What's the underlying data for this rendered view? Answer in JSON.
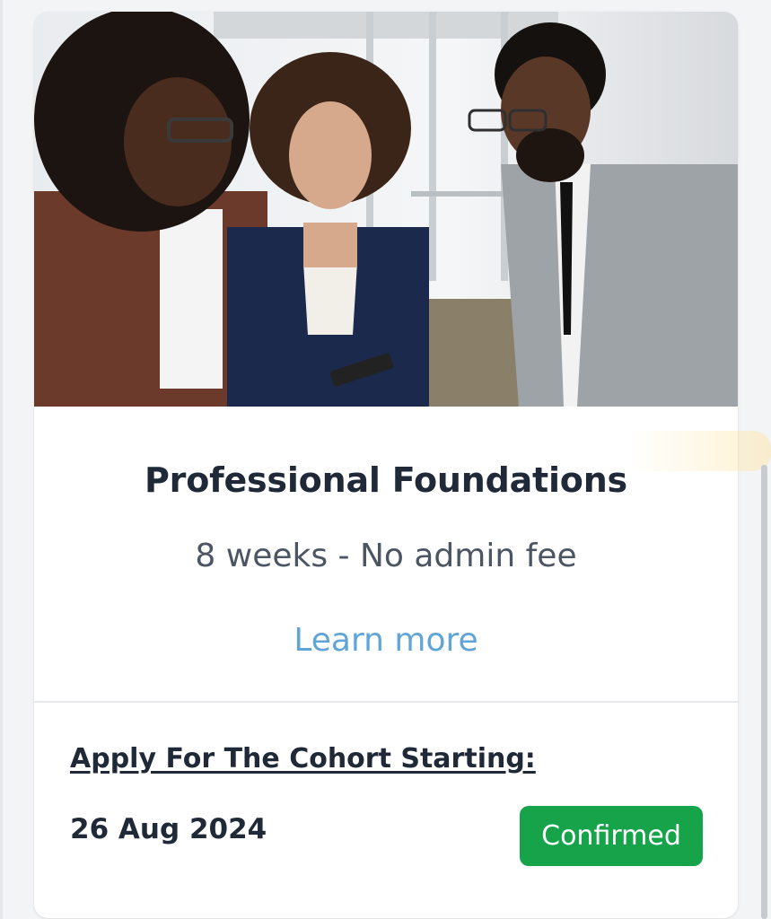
{
  "card": {
    "image_alt": "Three professionals looking at a phone",
    "title": "Professional Foundations",
    "subtitle": "8 weeks - No admin fee",
    "learn_more": "Learn more",
    "apply_heading": "Apply For The Cohort Starting:",
    "start_date": "26 Aug 2024",
    "status": "Confirmed"
  },
  "colors": {
    "status_badge": "#16a34a",
    "link": "#60a5d8",
    "title": "#1f2937"
  }
}
